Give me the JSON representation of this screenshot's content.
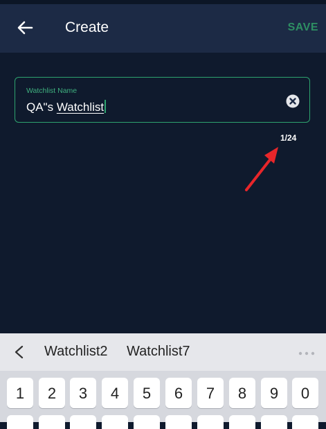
{
  "header": {
    "title": "Create",
    "save_label": "SAVE"
  },
  "field": {
    "label": "Watchlist Name",
    "value_prefix": "QA\"s ",
    "value_word": "Watchlist"
  },
  "counter": "1/24",
  "keyboard": {
    "suggestions": [
      "Watchlist2",
      "Watchlist7"
    ],
    "number_keys": [
      "1",
      "2",
      "3",
      "4",
      "5",
      "6",
      "7",
      "8",
      "9",
      "0"
    ]
  },
  "colors": {
    "accent": "#2ea46f",
    "background": "#0f1a2d",
    "appbar": "#1c2a45",
    "annotation": "#e8262a"
  }
}
